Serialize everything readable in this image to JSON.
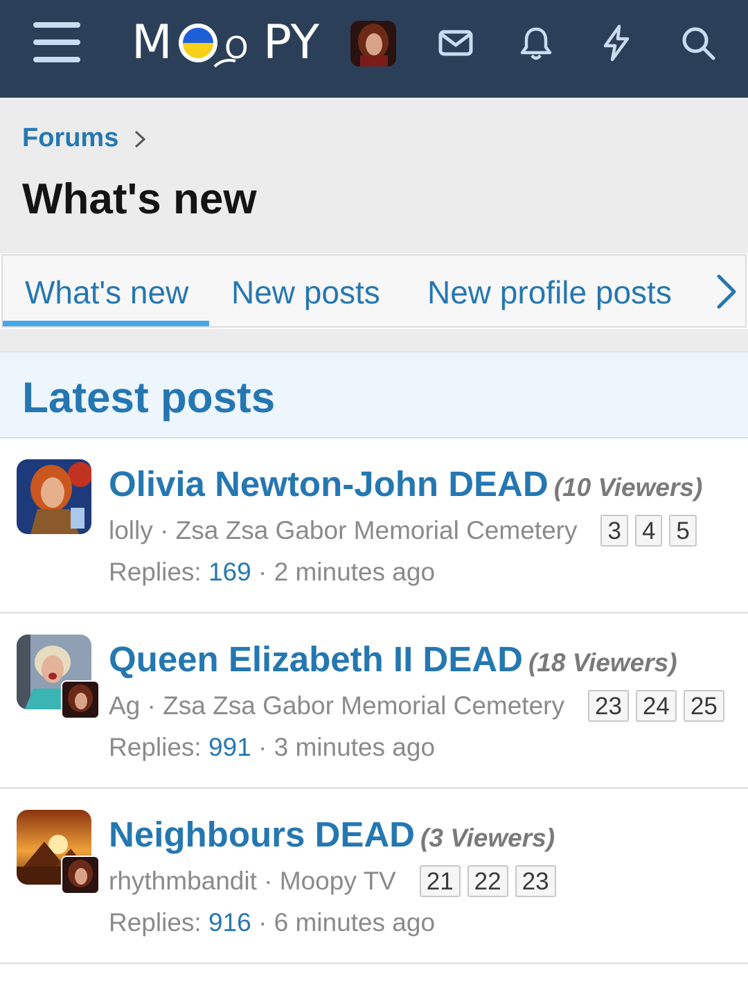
{
  "header": {
    "logo_text_left": "M",
    "logo_text_mid": "O",
    "logo_text_right": "PY",
    "icons": [
      "menu-icon",
      "envelope-icon",
      "bell-icon",
      "bolt-icon",
      "search-icon"
    ]
  },
  "breadcrumb": {
    "label": "Forums"
  },
  "page_title": "What's new",
  "tabs": [
    {
      "label": "What's new",
      "active": true
    },
    {
      "label": "New posts"
    },
    {
      "label": "New profile posts"
    }
  ],
  "section_title": "Latest posts",
  "posts": [
    {
      "title": "Olivia Newton-John DEAD",
      "viewers": "(10 Viewers)",
      "author": "lolly",
      "forum": "Zsa Zsa Gabor Memorial Cemetery",
      "pages": [
        "3",
        "4",
        "5"
      ],
      "replies_label": "Replies:",
      "replies": "169",
      "time": "2 minutes ago"
    },
    {
      "title": "Queen Elizabeth II DEAD",
      "viewers": "(18 Viewers)",
      "author": "Ag",
      "forum": "Zsa Zsa Gabor Memorial Cemetery",
      "pages": [
        "23",
        "24",
        "25"
      ],
      "replies_label": "Replies:",
      "replies": "991",
      "time": "3 minutes ago"
    },
    {
      "title": "Neighbours DEAD",
      "viewers": "(3 Viewers)",
      "author": "rhythmbandit",
      "forum": "Moopy TV",
      "pages": [
        "21",
        "22",
        "23"
      ],
      "replies_label": "Replies:",
      "replies": "916",
      "time": "6 minutes ago"
    }
  ],
  "colors": {
    "header_bg": "#2b4058",
    "link": "#2577b1",
    "tab_underline": "#47a7eb",
    "section_bg": "#edf5fd",
    "flag_blue": "#1f5fd6",
    "flag_yellow": "#f7d117"
  }
}
